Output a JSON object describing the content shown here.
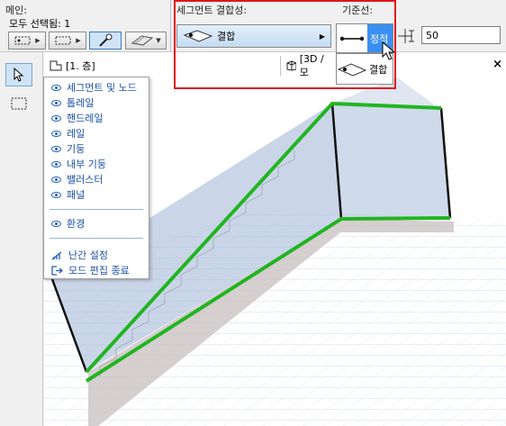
{
  "infobox": {
    "main_title": "메인:",
    "select_all": "모두 선택됨: 1",
    "segment_title": "세그먼트 결합성:",
    "segment_value": "결합",
    "ref_title": "기준선:",
    "offset_value": "50"
  },
  "join_options": [
    {
      "label": "정적",
      "selected": true
    },
    {
      "label": "결합",
      "selected": false
    }
  ],
  "tabs": {
    "floor_plan": "[1. 층]",
    "view3d": "[3D / 모"
  },
  "menu": {
    "items": [
      {
        "label": "세그먼트 및 노드",
        "icon": "eye-icon"
      },
      {
        "label": "톱레일",
        "icon": "eye-icon"
      },
      {
        "label": "핸드레일",
        "icon": "eye-icon"
      },
      {
        "label": "레일",
        "icon": "eye-icon"
      },
      {
        "label": "기둥",
        "icon": "eye-icon"
      },
      {
        "label": "내부 기둥",
        "icon": "eye-icon"
      },
      {
        "label": "밸러스터",
        "icon": "eye-icon"
      },
      {
        "label": "패널",
        "icon": "eye-icon"
      }
    ],
    "env": {
      "label": "환경",
      "icon": "eye-icon"
    },
    "settings": {
      "label": "난간 설정",
      "icon": "railing-settings-icon"
    },
    "exit": {
      "label": "모드 편집 종료",
      "icon": "exit-icon"
    }
  },
  "colors": {
    "highlight_red": "#e0141b",
    "railing_green": "#21b521",
    "selected_blue": "#3b8ff2",
    "menu_text": "#1a4fa3"
  }
}
